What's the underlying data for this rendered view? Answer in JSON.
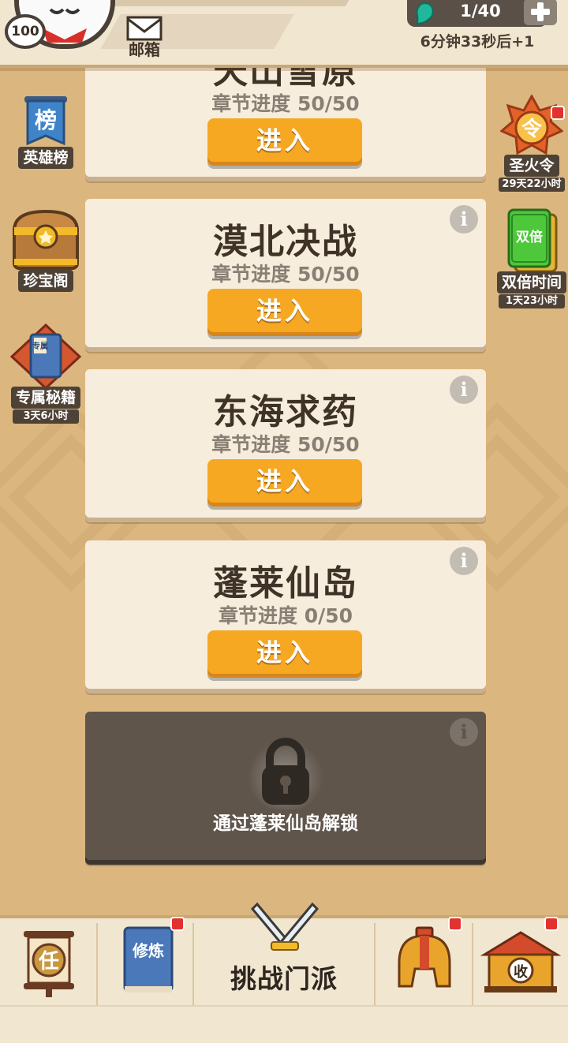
{
  "header": {
    "level": "100",
    "mail_label": "邮箱",
    "energy": "1/40",
    "timer": "6分钟33秒后+1"
  },
  "left_menu": [
    {
      "label": "英雄榜",
      "icon": "ranking-banner-icon",
      "icon_text": "榜"
    },
    {
      "label": "珍宝阁",
      "icon": "treasure-chest-icon"
    },
    {
      "label": "专属秘籍",
      "icon": "secret-book-icon",
      "icon_text": "专属",
      "sub": "3天6小时"
    }
  ],
  "right_menu": [
    {
      "label": "圣火令",
      "icon": "holy-fire-token-icon",
      "icon_text": "令",
      "sub": "29天22小时",
      "badge": true
    },
    {
      "label": "双倍时间",
      "icon": "double-time-card-icon",
      "icon_text": "双倍",
      "sub": "1天23小时"
    }
  ],
  "chapters": [
    {
      "title": "天山雪原",
      "progress": "章节进度 50/50",
      "button": "进入"
    },
    {
      "title": "漠北决战",
      "progress": "章节进度 50/50",
      "button": "进入"
    },
    {
      "title": "东海求药",
      "progress": "章节进度 50/50",
      "button": "进入"
    },
    {
      "title": "蓬莱仙岛",
      "progress": "章节进度 0/50",
      "button": "进入"
    }
  ],
  "locked_chapter": {
    "text": "通过蓬莱仙岛解锁"
  },
  "info_glyph": "i",
  "bottom_nav": {
    "task_icon_text": "任",
    "cultivate_icon_text": "修炼",
    "center_label": "挑战门派",
    "collect_icon_text": "收"
  },
  "colors": {
    "background": "#dbb77f",
    "card": "#f7eddc",
    "button": "#f6a823",
    "locked": "#5f554b",
    "badge": "#e3322d"
  }
}
